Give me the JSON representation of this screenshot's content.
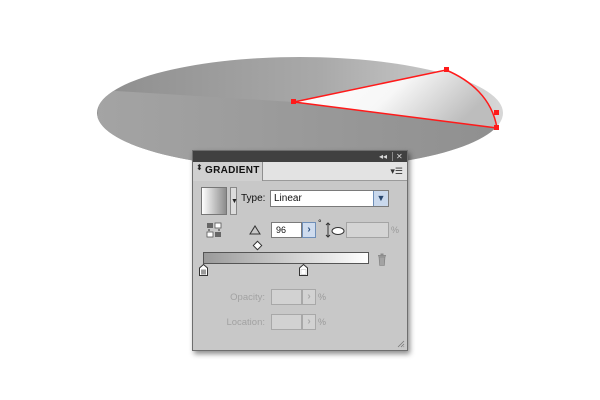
{
  "panel": {
    "title": "GRADIENT",
    "collapse_glyph": "◂◂",
    "close_glyph": "✕",
    "menu_glyph": "▾☰",
    "tab_arrows_glyph": "⬍"
  },
  "gradient": {
    "type_label": "Type:",
    "type_value": "Linear",
    "angle_value": "96",
    "angle_unit": "°",
    "aspect_unit": "%",
    "stops": [
      {
        "location": 0,
        "color": "#9a9a9a"
      },
      {
        "location": 0.6,
        "color": "#ffffff"
      }
    ],
    "midpoint": 0.34
  },
  "stop_fields": {
    "opacity_label": "Opacity:",
    "opacity_unit": "%",
    "location_label": "Location:",
    "location_unit": "%"
  },
  "icons": {
    "swatch_dropdown": "chevron-down-icon",
    "type_dropdown": "chevron-down-icon",
    "angle_arrow": "chevron-right-icon",
    "reverse": "reverse-gradient-icon",
    "angle": "angle-icon",
    "aspect": "aspect-ratio-icon",
    "delete": "trash-icon"
  },
  "colors": {
    "selection": "#ff1a1a",
    "panel_bg": "#c8c8c8",
    "accent_blue": "#c9d8ec"
  }
}
